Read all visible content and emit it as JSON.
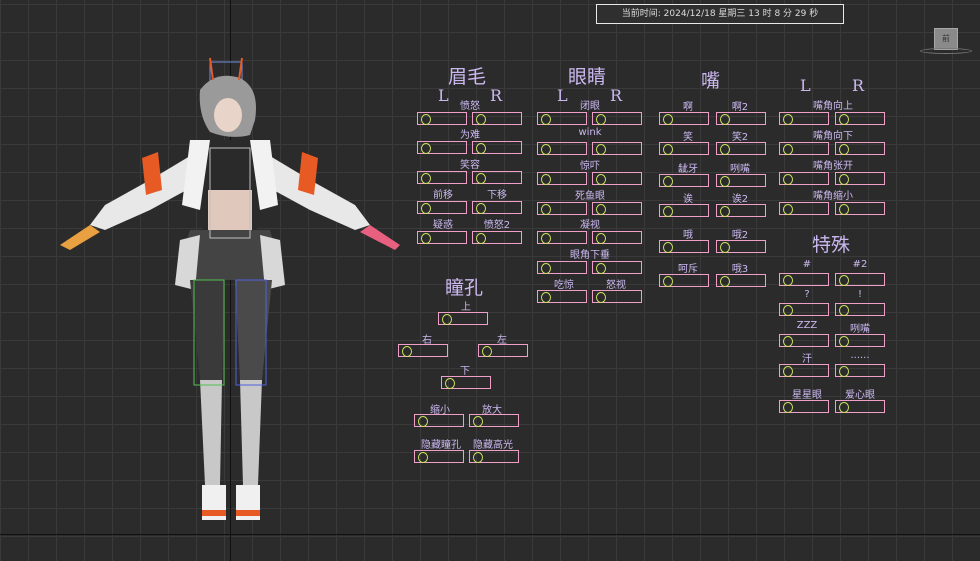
{
  "status": {
    "time_text": "当前时间:  2024/12/18  星期三  13 时 8 分 29 秒"
  },
  "viewport": {
    "nav_cube_label": "前"
  },
  "panels": {
    "eyebrows": {
      "title": "眉毛",
      "L": "L",
      "R": "R",
      "labels": [
        "愤怒",
        "为难",
        "笑容",
        "前移",
        "下移",
        "疑惑",
        "愤怒2"
      ]
    },
    "eyes": {
      "title": "眼睛",
      "L": "L",
      "R": "R",
      "labels": [
        "闭眼",
        "wink",
        "惊吓",
        "死鱼眼",
        "凝视",
        "眼角下垂",
        "吃惊",
        "怒视"
      ]
    },
    "mouth": {
      "title": "嘴",
      "labels": [
        "啊",
        "啊2",
        "笑",
        "笑2",
        "龇牙",
        "咧嘴",
        "诶",
        "诶2",
        "哦",
        "哦2",
        "呵斥",
        "哦3"
      ]
    },
    "mouth_corners": {
      "L": "L",
      "R": "R",
      "labels": [
        "嘴角向上",
        "嘴角向下",
        "嘴角张开",
        "嘴角缩小"
      ]
    },
    "pupils": {
      "title": "瞳孔",
      "labels": [
        "上",
        "右",
        "左",
        "下",
        "缩小",
        "放大",
        "隐藏瞳孔",
        "隐藏高光"
      ]
    },
    "special": {
      "title": "特殊",
      "labels": [
        "#",
        "#2",
        "?",
        "!",
        "ZZZ",
        "咧嘴",
        "汗",
        "......",
        "星星眼",
        "爱心眼"
      ]
    }
  },
  "colors": {
    "label": "#cbb8f0",
    "control_border": "#f0a0c8",
    "control_knob": "#c8e060",
    "accent_orange": "#e85a24"
  }
}
